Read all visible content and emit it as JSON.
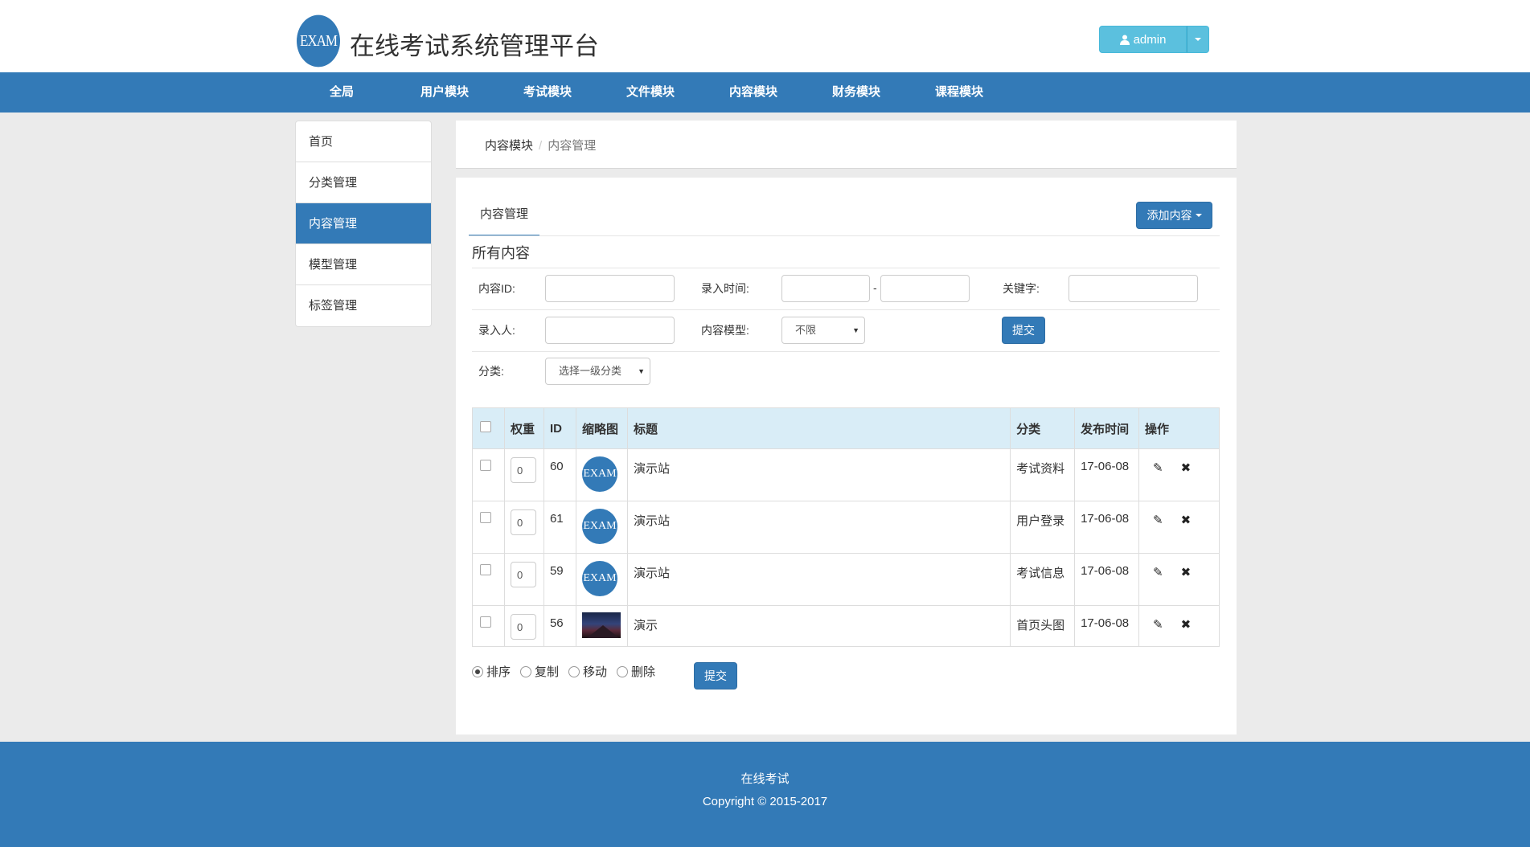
{
  "header": {
    "logo_text": "EXAM",
    "site_title": "在线考试系统管理平台",
    "user": {
      "name": "admin",
      "icon": "user-icon"
    }
  },
  "topnav": {
    "items": [
      "全局",
      "用户模块",
      "考试模块",
      "文件模块",
      "内容模块",
      "财务模块",
      "课程模块"
    ],
    "active": "内容模块"
  },
  "sidebar": {
    "items": [
      "首页",
      "分类管理",
      "内容管理",
      "模型管理",
      "标签管理"
    ],
    "active": "内容管理"
  },
  "breadcrumb": {
    "parent": "内容模块",
    "separator": "/",
    "current": "内容管理"
  },
  "main": {
    "tab_label": "内容管理",
    "add_button": "添加内容",
    "section_title": "所有内容",
    "filters": {
      "content_id_label": "内容ID:",
      "entry_time_label": "录入时间:",
      "date_separator": "-",
      "keyword_label": "关键字:",
      "author_label": "录入人:",
      "model_label": "内容模型:",
      "model_value": "不限",
      "submit": "提交",
      "category_label": "分类:",
      "category_value": "选择一级分类"
    },
    "table": {
      "headers": [
        "权重",
        "ID",
        "缩略图",
        "标题",
        "分类",
        "发布时间",
        "操作"
      ],
      "rows": [
        {
          "weight": "0",
          "id": "60",
          "thumb": "exam-logo",
          "title": "演示站",
          "category": "考试资料",
          "date": "17-06-08"
        },
        {
          "weight": "0",
          "id": "61",
          "thumb": "exam-logo",
          "title": "演示站",
          "category": "用户登录",
          "date": "17-06-08"
        },
        {
          "weight": "0",
          "id": "59",
          "thumb": "exam-logo",
          "title": "演示站",
          "category": "考试信息",
          "date": "17-06-08"
        },
        {
          "weight": "0",
          "id": "56",
          "thumb": "mountain-photo",
          "title": "演示",
          "category": "首页头图",
          "date": "17-06-08"
        }
      ],
      "row_actions": [
        "edit-icon",
        "delete-icon"
      ]
    },
    "bulk_actions": {
      "options": [
        "排序",
        "复制",
        "移动",
        "删除"
      ],
      "selected": "排序",
      "submit": "提交"
    }
  },
  "footer": {
    "line1": "在线考试",
    "line2": "Copyright © 2015-2017"
  },
  "colors": {
    "primary": "#337ab7",
    "info": "#5bc0de",
    "table_header": "#d9edf7",
    "background": "#ebebeb"
  }
}
